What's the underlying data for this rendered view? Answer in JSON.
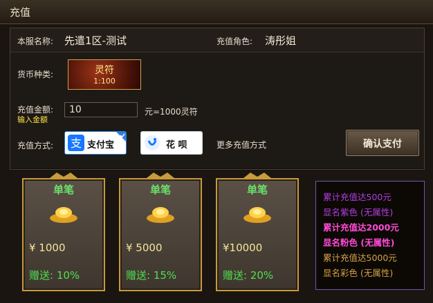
{
  "window": {
    "title": "充值"
  },
  "server": {
    "label": "本服名称:",
    "value": "先遣1区-测试"
  },
  "role": {
    "label": "充值角色:",
    "value": "涛彤姐"
  },
  "currency": {
    "label": "货币种类:",
    "name": "灵符",
    "rate": "1:100"
  },
  "amount": {
    "label": "充值金额:",
    "hint": "输入金额",
    "value": "10",
    "conversion": "元=1000灵符"
  },
  "payment": {
    "label": "充值方式:",
    "alipay": "支付宝",
    "huabei": "花 呗",
    "more": "更多充值方式"
  },
  "confirm_label": "确认支付",
  "cards": [
    {
      "header": "单笔",
      "amount": "¥ 1000",
      "bonus": "赠送: 10%"
    },
    {
      "header": "单笔",
      "amount": "¥ 5000",
      "bonus": "赠送: 15%"
    },
    {
      "header": "单笔",
      "amount": "¥10000",
      "bonus": "赠送: 20%"
    }
  ],
  "info": {
    "lines": [
      {
        "text": "累计充值达500元",
        "color": "#b23ee0"
      },
      {
        "text": "显名紫色 (无属性)",
        "color": "#b23ee0"
      },
      {
        "text": "累计充值达2000元",
        "color": "#ff4ad8"
      },
      {
        "text": "显名粉色 (无属性)",
        "color": "#ff4ad8"
      },
      {
        "text": "累计充值达5000元",
        "color": "#d8a24a"
      },
      {
        "text": "显名彩色 (无属性)",
        "color": "#d8a24a"
      }
    ]
  },
  "colors": {
    "gold": "#c89a3a",
    "green": "#4fe04f",
    "alipay_blue": "#1677ff"
  }
}
